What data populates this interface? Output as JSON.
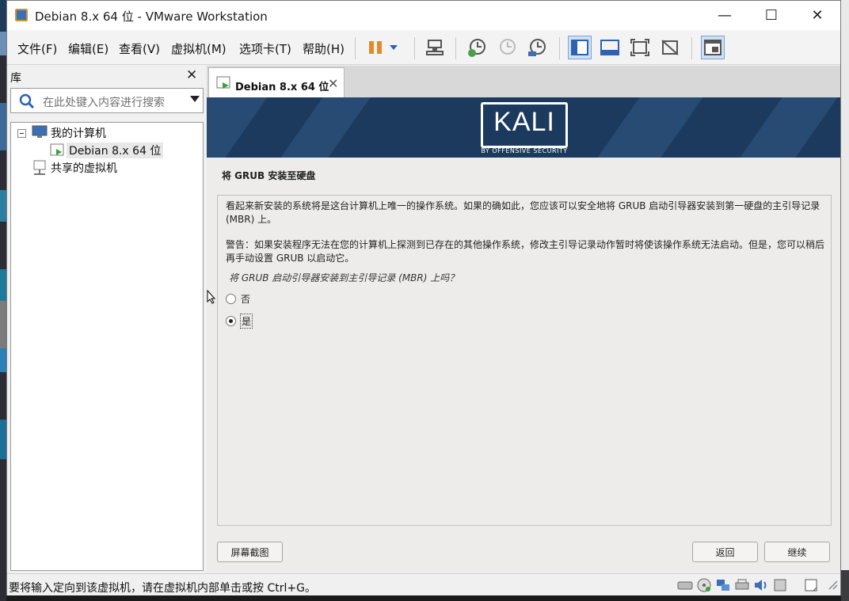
{
  "window": {
    "title": "Debian 8.x 64 位 - VMware Workstation",
    "minimize": "—",
    "maximize": "☐",
    "close": "✕"
  },
  "menu": {
    "file": "文件(F)",
    "edit": "编辑(E)",
    "view": "查看(V)",
    "vm": "虚拟机(M)",
    "tabs": "选项卡(T)",
    "help": "帮助(H)"
  },
  "library": {
    "title": "库",
    "close": "✕",
    "search_placeholder": "在此处键入内容进行搜索",
    "tree": {
      "my_computer": "我的计算机",
      "vm_item": "Debian 8.x 64 位",
      "shared": "共享的虚拟机"
    }
  },
  "vm_tab": {
    "label": "Debian 8.x 64 位",
    "close": "✕"
  },
  "guest": {
    "logo_text": "KALI",
    "logo_sub": "BY OFFENSIVE SECURITY",
    "step_title": "将 GRUB 安装至硬盘",
    "paragraph1": "看起来新安装的系统将是这台计算机上唯一的操作系统。如果的确如此，您应该可以安全地将 GRUB 启动引导器安装到第一硬盘的主引导记录 (MBR) 上。",
    "paragraph2": "警告：如果安装程序无法在您的计算机上探测到已存在的其他操作系统，修改主引导记录动作暂时将使该操作系统无法启动。但是，您可以稍后再手动设置 GRUB 以启动它。",
    "question": "将 GRUB 启动引导器安装到主引导记录 (MBR) 上吗？",
    "options": [
      {
        "label": "否",
        "selected": false
      },
      {
        "label": "是",
        "selected": true
      }
    ],
    "screenshot_button": "屏幕截图",
    "back_button": "返回",
    "continue_button": "继续"
  },
  "status": {
    "text": "要将输入定向到该虚拟机，请在虚拟机内部单击或按 Ctrl+G。"
  },
  "colors": {
    "banner": "#1b3a5e",
    "pause_icon": "#e08c2b",
    "accent": "#3b6fb6"
  }
}
